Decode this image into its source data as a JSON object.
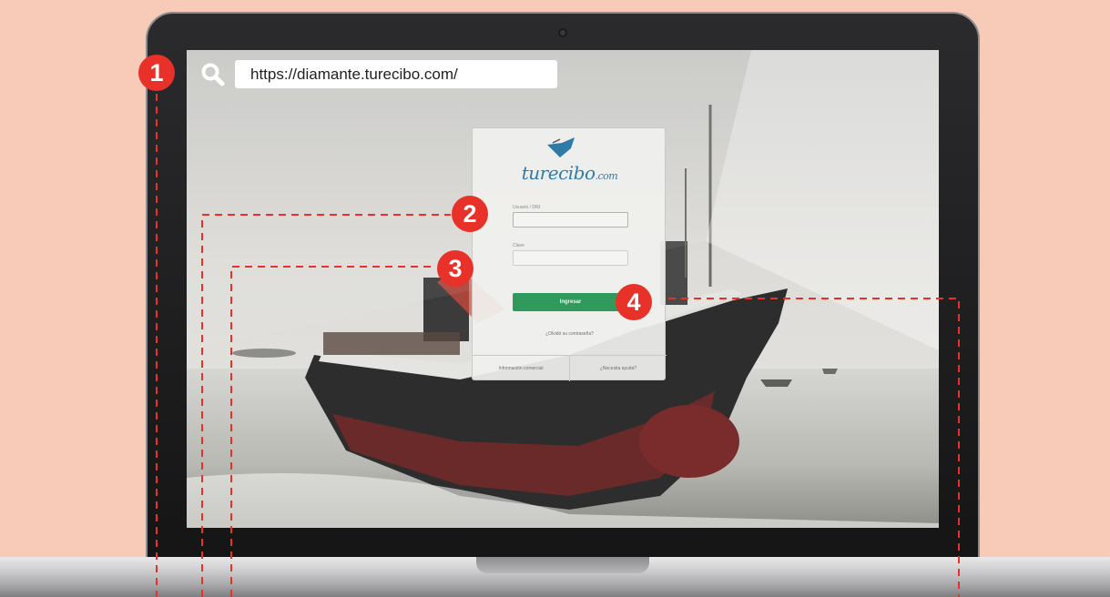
{
  "browser": {
    "url": "https://diamante.turecibo.com/"
  },
  "login": {
    "brand_main": "turecibo",
    "brand_suffix": ".com",
    "user_label": "Usuario / DNI",
    "password_label": "Clave",
    "submit_label": "Ingresar",
    "forgot_label": "¿Olvidó su contraseña?",
    "footer_left": "Información comercial",
    "footer_right": "¿Necesita ayuda?"
  },
  "markers": [
    "1",
    "2",
    "3",
    "4"
  ],
  "colors": {
    "background": "#f8cbb8",
    "marker": "#e73129",
    "login_button": "#2f9a5c",
    "brand": "#2f7ba8"
  },
  "icons": [
    "search-icon",
    "logo-bird-icon",
    "camera-icon"
  ]
}
